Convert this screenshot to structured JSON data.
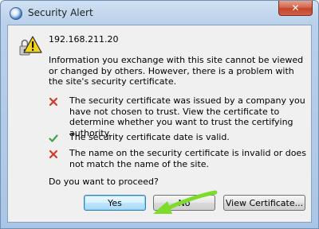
{
  "window": {
    "title": "Security Alert",
    "close_label": "✕"
  },
  "alert": {
    "host": "192.168.211.20",
    "message": "Information you exchange with this site cannot be viewed or changed by others. However, there is a problem with the site's security certificate.",
    "items": [
      {
        "status": "error",
        "icon": "red-x-icon",
        "text": "The security certificate was issued by a company you have not chosen to trust. View the certificate to determine whether you want to trust the certifying authority."
      },
      {
        "status": "ok",
        "icon": "green-check-icon",
        "text": "The security certificate date is valid."
      },
      {
        "status": "error",
        "icon": "red-x-icon",
        "text": "The name on the security certificate is invalid or does not match the name of the site."
      }
    ],
    "question": "Do you want to proceed?"
  },
  "buttons": {
    "yes": "Yes",
    "no": "No",
    "view_certificate": "View Certificate..."
  },
  "colors": {
    "error": "#d43a2a",
    "ok": "#3aa64a",
    "annotation_arrow": "#7ddb2a"
  }
}
